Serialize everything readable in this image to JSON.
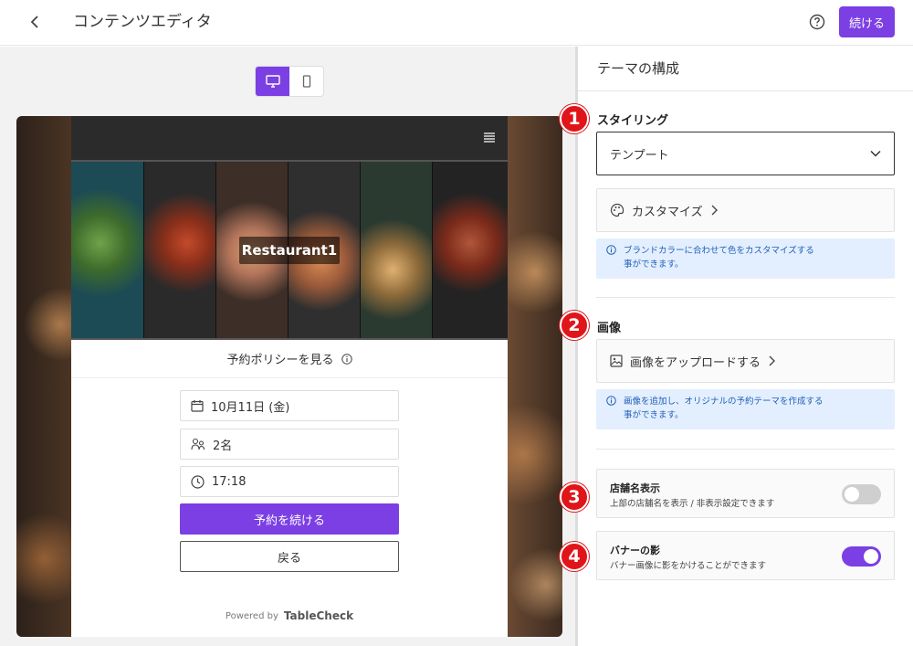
{
  "header": {
    "title": "コンテンツエディタ",
    "continue_label": "続ける"
  },
  "preview": {
    "device_options": [
      "desktop",
      "mobile"
    ],
    "selected_device": "desktop",
    "restaurant_name": "Restaurant1",
    "policy_link": "予約ポリシーを見る",
    "date": "10月11日 (金)",
    "party_size": "2名",
    "time": "17:18",
    "primary_button": "予約を続ける",
    "secondary_button": "戻る",
    "powered_by": "Powered by",
    "brand": "TableCheck"
  },
  "panel": {
    "title": "テーマの構成",
    "styling": {
      "heading": "スタイリング",
      "select_value": "テンプート",
      "customize_label": "カスタマイズ",
      "info_line1": "ブランドカラーに合わせて色をカスタマイズする",
      "info_line2": "事ができます。"
    },
    "image": {
      "heading": "画像",
      "upload_label": "画像をアップロードする",
      "info_line1": "画像を追加し、オリジナルの予約テーマを作成する",
      "info_line2": "事ができます。"
    },
    "store_name": {
      "title": "店舗名表示",
      "subtitle": "上部の店舗名を表示 / 非表示設定できます",
      "enabled": false
    },
    "banner_shadow": {
      "title": "バナーの影",
      "subtitle": "バナー画像に影をかけることができます",
      "enabled": true
    }
  },
  "markers": [
    "1",
    "2",
    "3",
    "4"
  ],
  "colors": {
    "accent": "#7b3fe4",
    "marker": "#e0151a",
    "info_bg": "#e3efff",
    "info_text": "#1f5fb8"
  }
}
